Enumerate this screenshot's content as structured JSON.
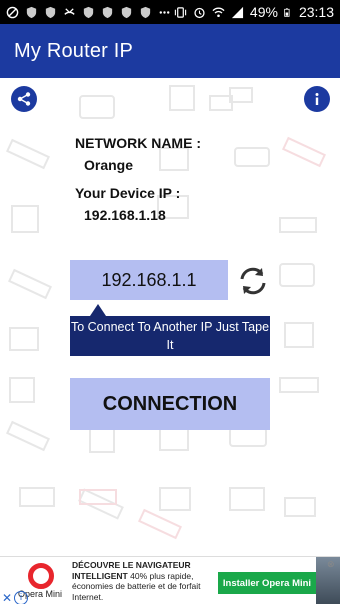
{
  "status_bar": {
    "battery": "49%",
    "time": "23:13"
  },
  "app_bar": {
    "title": "My Router IP"
  },
  "actions": {
    "share_icon": "share-icon",
    "info_icon": "info-icon"
  },
  "network": {
    "name_label": "NETWORK NAME :",
    "name_value": "Orange",
    "device_ip_label": "Your Device IP :",
    "device_ip_value": "192.168.1.18"
  },
  "router": {
    "ip": "192.168.1.1",
    "refresh_icon": "refresh-icon",
    "tooltip": "To Connect To Another IP Just Tape It"
  },
  "connection_button": {
    "label": "CONNECTION"
  },
  "ad": {
    "brand": "Opera Mini",
    "headline": "DÉCOUVRE LE NAVIGATEUR INTELLIGENT",
    "body": "40% plus rapide, économies de batterie et de forfait Internet.",
    "cta": "Installer Opera Mini",
    "close_icon": "close-icon",
    "info_icon": "ad-info-icon"
  },
  "colors": {
    "primary": "#1c3aa0",
    "button_fill": "#b4bef1",
    "tooltip": "#16286e",
    "cta": "#1aa84a"
  }
}
